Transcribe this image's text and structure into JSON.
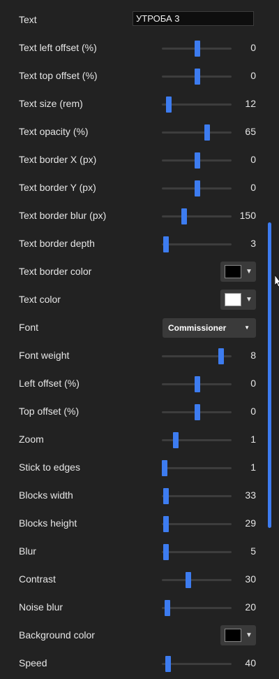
{
  "accent_color": "#3d7cf0",
  "text_field": {
    "label": "Text",
    "value": "УТРОБА 3"
  },
  "sliders": [
    {
      "key": "text-left-offset",
      "label": "Text left offset (%)",
      "value": "0",
      "fraction": 0.51
    },
    {
      "key": "text-top-offset",
      "label": "Text top offset (%)",
      "value": "0",
      "fraction": 0.51
    },
    {
      "key": "text-size",
      "label": "Text size (rem)",
      "value": "12",
      "fraction": 0.1
    },
    {
      "key": "text-opacity",
      "label": "Text opacity (%)",
      "value": "65",
      "fraction": 0.65
    },
    {
      "key": "text-border-x",
      "label": "Text border X (px)",
      "value": "0",
      "fraction": 0.51
    },
    {
      "key": "text-border-y",
      "label": "Text border Y (px)",
      "value": "0",
      "fraction": 0.51
    },
    {
      "key": "text-border-blur",
      "label": "Text border blur (px)",
      "value": "150",
      "fraction": 0.32
    },
    {
      "key": "text-border-depth",
      "label": "Text border depth",
      "value": "3",
      "fraction": 0.06
    }
  ],
  "text_border_color": {
    "label": "Text border color",
    "color": "#000000"
  },
  "text_color": {
    "label": "Text color",
    "color": "#ffffff"
  },
  "font": {
    "label": "Font",
    "selected": "Commissioner"
  },
  "sliders2": [
    {
      "key": "font-weight",
      "label": "Font weight",
      "value": "8",
      "fraction": 0.85
    },
    {
      "key": "left-offset",
      "label": "Left offset (%)",
      "value": "0",
      "fraction": 0.51
    },
    {
      "key": "top-offset",
      "label": "Top offset (%)",
      "value": "0",
      "fraction": 0.51
    },
    {
      "key": "zoom",
      "label": "Zoom",
      "value": "1",
      "fraction": 0.2
    },
    {
      "key": "stick-to-edges",
      "label": "Stick to edges",
      "value": "1",
      "fraction": 0.04
    },
    {
      "key": "blocks-width",
      "label": "Blocks width",
      "value": "33",
      "fraction": 0.06
    },
    {
      "key": "blocks-height",
      "label": "Blocks height",
      "value": "29",
      "fraction": 0.06
    },
    {
      "key": "blur",
      "label": "Blur",
      "value": "5",
      "fraction": 0.06
    },
    {
      "key": "contrast",
      "label": "Contrast",
      "value": "30",
      "fraction": 0.38
    },
    {
      "key": "noise-blur",
      "label": "Noise blur",
      "value": "20",
      "fraction": 0.08
    }
  ],
  "background_color": {
    "label": "Background color",
    "color": "#000000"
  },
  "speed": {
    "label": "Speed",
    "value": "40",
    "fraction": 0.09
  }
}
